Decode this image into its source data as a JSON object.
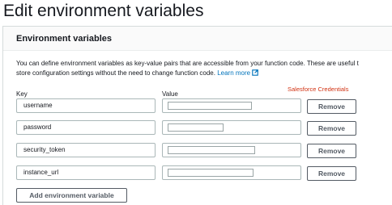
{
  "page": {
    "title": "Edit environment variables"
  },
  "panel": {
    "title": "Environment variables",
    "description_line1": "You can define environment variables as key-value pairs that are accessible from your function code. These are useful t",
    "description_line2": "store configuration settings without the need to change function code.",
    "learn_more": "Learn more",
    "learn_more_icon": "external-link-icon",
    "annotation": "Salesforce Credentials",
    "annotation_color": "#d13212",
    "link_color": "#0073bb",
    "key_header": "Key",
    "value_header": "Value",
    "variables": [
      {
        "key": "username",
        "value": ""
      },
      {
        "key": "password",
        "value": ""
      },
      {
        "key": "security_token",
        "value": ""
      },
      {
        "key": "instance_url",
        "value": ""
      }
    ],
    "remove_label": "Remove",
    "add_label": "Add environment variable"
  }
}
